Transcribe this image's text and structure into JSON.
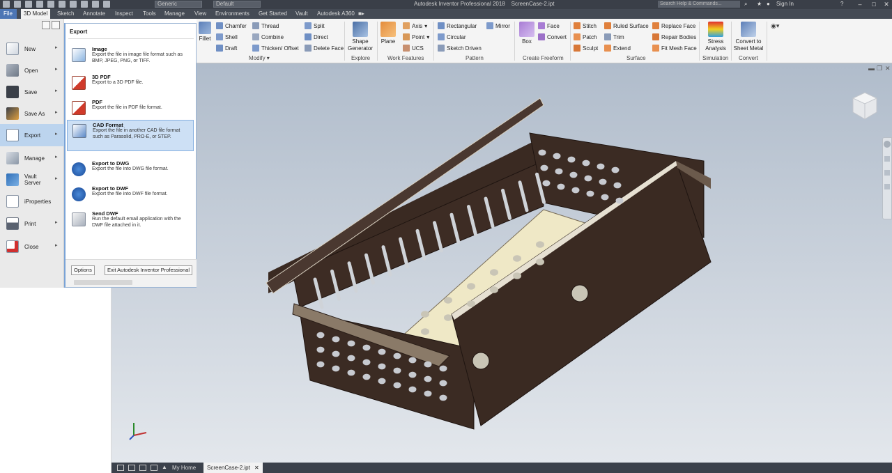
{
  "app": {
    "title": "Autodesk Inventor Professional 2018",
    "document": "ScreenCase-2.ipt",
    "search_placeholder": "Search Help & Commands...",
    "sign_in": "Sign In",
    "material": "Generic",
    "appearance": "Default"
  },
  "tabs": [
    "File",
    "3D Model",
    "Sketch",
    "Annotate",
    "Inspect",
    "Tools",
    "Manage",
    "View",
    "Environments",
    "Get Started",
    "Vault",
    "Autodesk A360"
  ],
  "ribbon": {
    "fillet": "Fillet",
    "chamfer": "Chamfer",
    "shell": "Shell",
    "draft": "Draft",
    "thread": "Thread",
    "combine": "Combine",
    "thicken_offset": "Thicken/ Offset",
    "split": "Split",
    "direct": "Direct",
    "delete_face": "Delete Face",
    "modify_label": "Modify",
    "shape_generator": "Shape\nGenerator",
    "explore_label": "Explore",
    "plane": "Plane",
    "axis": "Axis",
    "point": "Point",
    "ucs": "UCS",
    "work_features_label": "Work Features",
    "rectangular": "Rectangular",
    "circular": "Circular",
    "sketch_driven": "Sketch Driven",
    "mirror": "Mirror",
    "pattern_label": "Pattern",
    "box": "Box",
    "face": "Face",
    "convert": "Convert",
    "create_freeform_label": "Create Freeform",
    "stitch": "Stitch",
    "patch": "Patch",
    "sculpt": "Sculpt",
    "ruled_surface": "Ruled Surface",
    "trim": "Trim",
    "extend": "Extend",
    "replace_face": "Replace Face",
    "repair_bodies": "Repair Bodies",
    "fit_mesh_face": "Fit Mesh Face",
    "surface_label": "Surface",
    "stress_analysis": "Stress\nAnalysis",
    "simulation_label": "Simulation",
    "convert_to_sheet_metal": "Convert to\nSheet Metal",
    "convert_label": "Convert"
  },
  "file_menu": {
    "items": [
      "New",
      "Open",
      "Save",
      "Save As",
      "Export",
      "Manage",
      "Vault\nServer",
      "iProperties",
      "Print",
      "Close"
    ],
    "selected": "Export"
  },
  "export_submenu": {
    "header": "Export",
    "items": [
      {
        "title": "Image",
        "desc": "Export the file in image file format such as BMP, JPEG, PNG, or TIFF."
      },
      {
        "title": "3D PDF",
        "desc": "Export to a 3D PDF file."
      },
      {
        "title": "PDF",
        "desc": "Export the file in PDF file format."
      },
      {
        "title": "CAD Format",
        "desc": "Export the file in another CAD file format such as Parasolid, PRO-E, or STEP."
      },
      {
        "title": "Export to DWG",
        "desc": "Export the file into DWG file format."
      },
      {
        "title": "Export to DWF",
        "desc": "Export the file into DWF file format."
      },
      {
        "title": "Send DWF",
        "desc": "Run the default email application with the DWF file attached in it."
      }
    ],
    "selected": "CAD Format",
    "options_button": "Options",
    "exit_button": "Exit Autodesk Inventor Professional"
  },
  "bottom": {
    "home_tab": "My Home",
    "doc_tab": "ScreenCase-2.ipt"
  },
  "colors": {
    "accent": "#4d76b5",
    "part_dark": "#3b2a22",
    "part_light": "#f1ecd0"
  },
  "icons": {
    "close": "close-icon",
    "viewcube": "viewcube-icon",
    "axis_triad": "axis-triad-icon"
  }
}
